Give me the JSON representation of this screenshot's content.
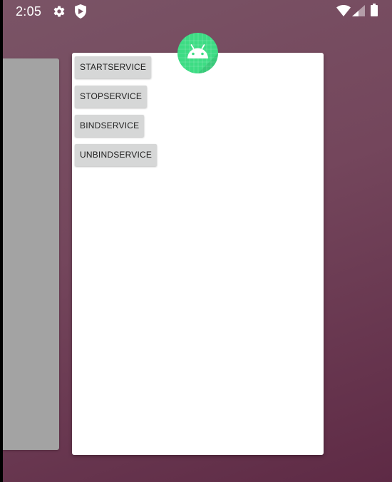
{
  "status_bar": {
    "time": "2:05",
    "left_icons": [
      "settings-icon",
      "shield-icon"
    ],
    "right_icons": [
      "wifi-icon",
      "cell-signal-icon",
      "battery-icon"
    ]
  },
  "recents": {
    "app_icon": "android-app-icon",
    "buttons": [
      {
        "label": "STARTSERVICE"
      },
      {
        "label": "STOPSERVICE"
      },
      {
        "label": "BINDSERVICE"
      },
      {
        "label": "UNBINDSERVICE"
      }
    ]
  },
  "colors": {
    "background": "#74465c",
    "card": "#ffffff",
    "previous_card": "#a3a3a3",
    "button": "#d6d7d7",
    "app_icon": "#3ddc84"
  }
}
